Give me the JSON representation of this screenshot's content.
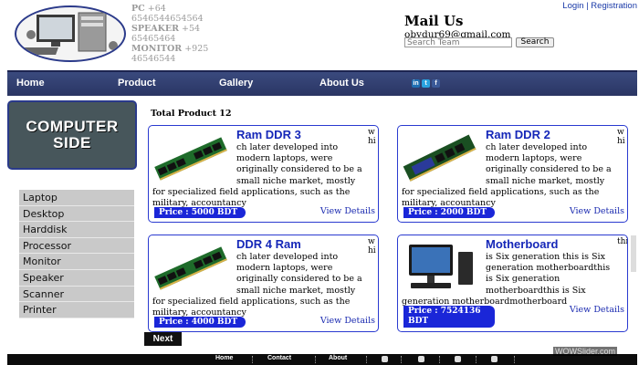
{
  "header": {
    "specs": [
      {
        "key": "PC",
        "value": "+64 6546544654564"
      },
      {
        "key": "SPEAKER",
        "value": "+54 65465464"
      },
      {
        "key": "MONITOR",
        "value": "+925 46546544"
      }
    ],
    "mail_title": "Mail Us",
    "email": "obydur69@gmail.com",
    "search_placeholder": "Search Team",
    "search_button": "Search",
    "login": "Login",
    "separator": "|",
    "registration": "Registration"
  },
  "nav": {
    "items": [
      "Home",
      "Product",
      "Gallery",
      "About Us"
    ],
    "social_icons": [
      "linkedin-icon",
      "twitter-icon",
      "facebook-icon"
    ]
  },
  "sidebar": {
    "logo_line1": "COMPUTER",
    "logo_line2": "SIDE",
    "categories": [
      "Laptop",
      "Desktop",
      "Harddisk",
      "Processor",
      "Monitor",
      "Speaker",
      "Scanner",
      "Printer"
    ]
  },
  "main": {
    "total_label": "Total Product 12",
    "next_button": "Next",
    "view_details": "View Details",
    "products": [
      {
        "name": "Ram DDR 3",
        "side_text": "w hi",
        "description": "ch later developed into modern laptops, were originally considered to be a small niche market, mostly for specialized field applications, such as the military, accountancy",
        "price": "Price : 5000 BDT"
      },
      {
        "name": "Ram DDR 2",
        "side_text": "w hi",
        "description": "ch later developed into modern laptops, were originally considered to be a small niche market, mostly for specialized field applications, such as the military, accountancy",
        "price": "Price : 2000 BDT"
      },
      {
        "name": "DDR 4 Ram",
        "side_text": "w hi",
        "description": "ch later developed into modern laptops, were originally considered to be a small niche market, mostly for specialized field applications, such as the military, accountancy",
        "price": "Price : 4000 BDT"
      },
      {
        "name": "Motherboard",
        "side_text": "this",
        "description": "is Six generation this is Six generation motherboardthis is Six generation motherboardthis is Six generation motherboardmotherboard",
        "price": "Price : 7524136 BDT"
      }
    ]
  },
  "footer": {
    "links": [
      "Home",
      "Contact",
      "About"
    ],
    "icons": [
      "facebook-icon",
      "twitter-icon",
      "share-icon",
      "chat-icon"
    ]
  },
  "watermark": "WOWSlider.com",
  "colors": {
    "accent": "#1527b8",
    "nav_bg": "#2f3c6e",
    "price_bg": "#1a26d8",
    "sidebar_logo_bg": "#47565b"
  }
}
